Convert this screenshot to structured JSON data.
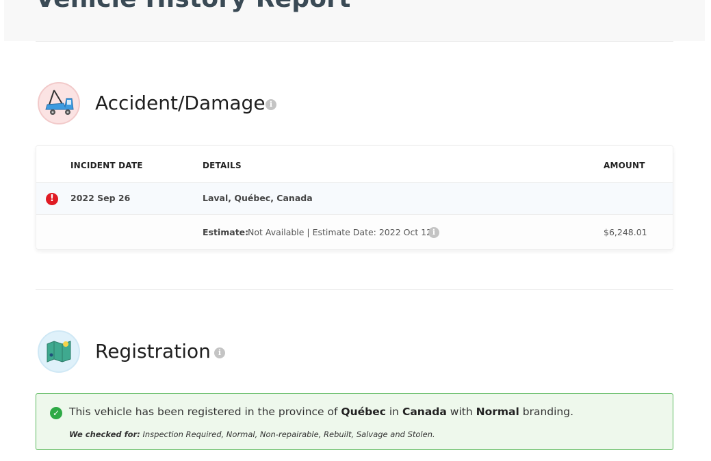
{
  "page": {
    "title": "Vehicle History Report"
  },
  "accident": {
    "title": "Accident/Damage",
    "icon": "tow-truck-icon",
    "table": {
      "headers": {
        "date": "INCIDENT DATE",
        "details": "DETAILS",
        "amount": "AMOUNT"
      },
      "incident": {
        "date": "2022 Sep 26",
        "location": "Laval, Québec, Canada",
        "estimate_label": "Estimate:",
        "estimate_value": "Not Available | Estimate Date: 2022 Oct 12",
        "amount": "$6,248.01"
      }
    }
  },
  "registration": {
    "title": "Registration",
    "icon": "map-icon",
    "notice": {
      "pre": "This vehicle has been registered in the province of",
      "province": "Québec",
      "in": "in",
      "country": "Canada",
      "with": "with",
      "branding": "Normal",
      "post": "branding.",
      "checked_label": "We checked for:",
      "checked_list": "Inspection Required, Normal, Non-repairable, Rebuilt, Salvage and Stolen."
    }
  },
  "colors": {
    "alert": "#e01b24",
    "success": "#2eaa46",
    "notice_bg": "#eef8ec",
    "notice_border": "#59b85b"
  }
}
